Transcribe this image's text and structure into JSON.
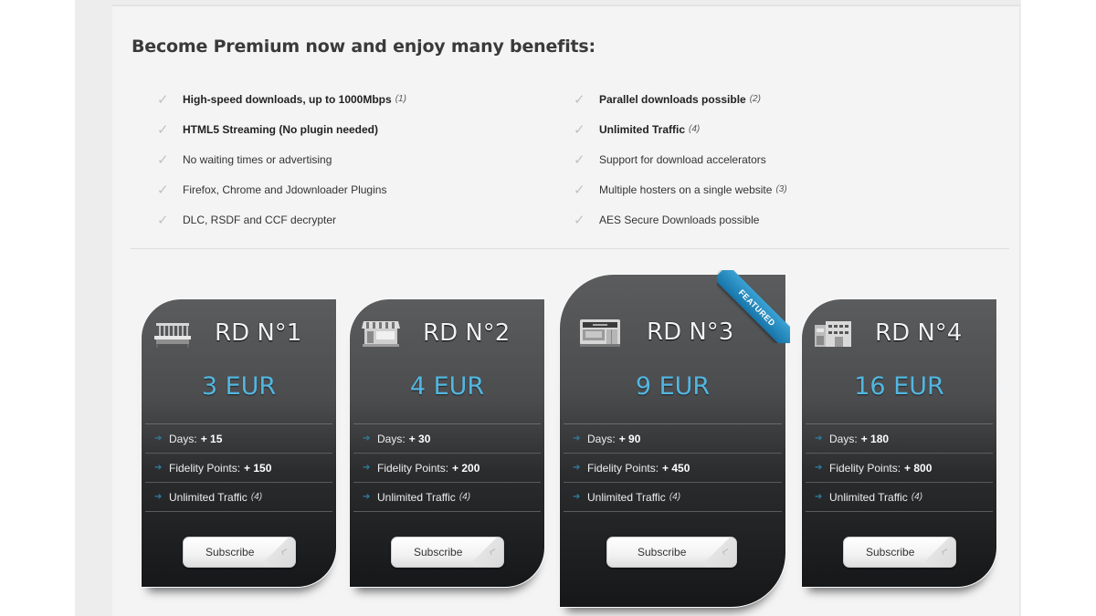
{
  "headline": "Become Premium now and enjoy many benefits:",
  "benefits_left": [
    {
      "text": "High-speed downloads, up to 1000Mbps",
      "note": "(1)",
      "bold": true
    },
    {
      "text": "HTML5 Streaming (No plugin needed)",
      "note": "",
      "bold": true
    },
    {
      "text": "No waiting times or advertising",
      "note": "",
      "bold": false
    },
    {
      "text": "Firefox, Chrome and Jdownloader Plugins",
      "note": "",
      "bold": false
    },
    {
      "text": "DLC, RSDF and CCF decrypter",
      "note": "",
      "bold": false
    }
  ],
  "benefits_right": [
    {
      "text": "Parallel downloads possible",
      "note": "(2)",
      "bold": true
    },
    {
      "text": "Unlimited Traffic",
      "note": "(4)",
      "bold": true
    },
    {
      "text": "Support for download accelerators",
      "note": "",
      "bold": false
    },
    {
      "text": "Multiple hosters on a single website",
      "note": "(3)",
      "bold": false
    },
    {
      "text": "AES Secure Downloads possible",
      "note": "",
      "bold": false
    }
  ],
  "check_glyph": "✓",
  "arrow_glyph": "➔",
  "plans": [
    {
      "name": "RD N°1",
      "price": "3 EUR",
      "icon": "bench-icon",
      "days_label": "Days:",
      "days": "+ 15",
      "points_label": "Fidelity Points:",
      "points": "+ 150",
      "traffic_label": "Unlimited Traffic",
      "traffic_note": "(4)",
      "button": "Subscribe"
    },
    {
      "name": "RD N°2",
      "price": "4 EUR",
      "icon": "market-stall-icon",
      "days_label": "Days:",
      "days": "+ 30",
      "points_label": "Fidelity Points:",
      "points": "+ 200",
      "traffic_label": "Unlimited Traffic",
      "traffic_note": "(4)",
      "button": "Subscribe"
    },
    {
      "name": "RD N°3",
      "price": "9 EUR",
      "icon": "shop-icon",
      "featured": true,
      "days_label": "Days:",
      "days": "+ 90",
      "points_label": "Fidelity Points:",
      "points": "+ 450",
      "traffic_label": "Unlimited Traffic",
      "traffic_note": "(4)",
      "button": "Subscribe"
    },
    {
      "name": "RD N°4",
      "price": "16 EUR",
      "icon": "office-building-icon",
      "days_label": "Days:",
      "days": "+ 180",
      "points_label": "Fidelity Points:",
      "points": "+ 800",
      "traffic_label": "Unlimited Traffic",
      "traffic_note": "(4)",
      "button": "Subscribe"
    }
  ],
  "featured_label": "FEATURED",
  "colors": {
    "price": "#52b7e0",
    "ribbon": "#1f86bd",
    "card_top": "#5b5c5e",
    "card_bottom": "#151719"
  }
}
